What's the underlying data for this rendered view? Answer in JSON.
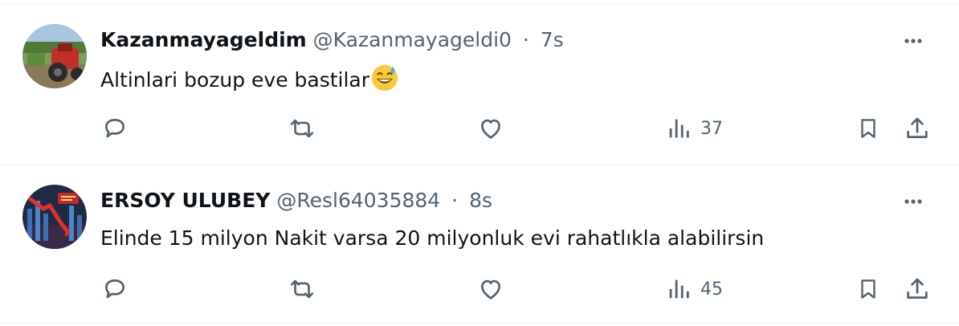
{
  "tweets": [
    {
      "name": "Kazanmayageldim",
      "handle": "@Kazanmayageldi0",
      "separator": "·",
      "time": "7s",
      "text": "Altinlari bozup eve bastilar",
      "emoji": "grinning-face-with-sweat",
      "views": "37",
      "avatar": "avatar-tractor"
    },
    {
      "name": "ERSOY ULUBEY",
      "handle": "@Resl64035884",
      "separator": "·",
      "time": "8s",
      "text": "Elinde 15 milyon Nakit varsa 20 milyonluk evi rahatlıkla alabilirsin",
      "views": "45",
      "avatar": "avatar-market-crash"
    }
  ],
  "icons": {
    "more": "more-icon",
    "reply": "reply-icon",
    "retweet": "retweet-icon",
    "like": "like-icon",
    "views": "views-icon",
    "bookmark": "bookmark-icon",
    "share": "share-icon"
  },
  "colors": {
    "text": "#0f1419",
    "secondary": "#536471",
    "border": "#eff3f4"
  }
}
